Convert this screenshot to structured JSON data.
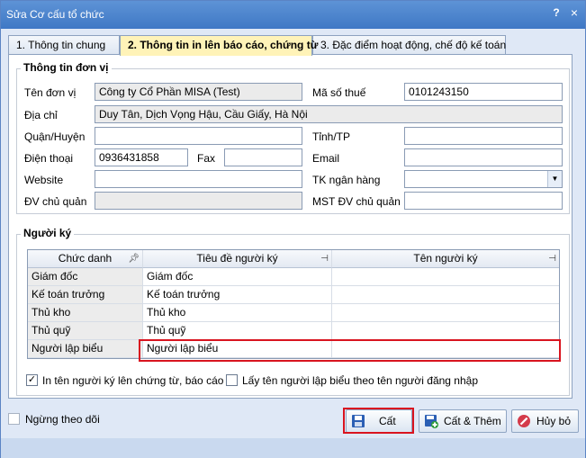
{
  "window": {
    "title": "Sửa Cơ cấu tổ chức",
    "help_label": "?",
    "close_label": "×"
  },
  "tabs": [
    {
      "label": "1. Thông tin chung"
    },
    {
      "label": "2. Thông tin in lên báo cáo, chứng từ"
    },
    {
      "label": "3. Đặc điểm hoạt động, chế độ kế toán"
    }
  ],
  "unit_info": {
    "title": "Thông tin đơn vị",
    "name_label": "Tên đơn vị",
    "name_value": "Công ty Cổ Phần MISA (Test)",
    "tax_label": "Mã số thuế",
    "tax_value": "0101243150",
    "address_label": "Địa chỉ",
    "address_value": "Duy Tân, Dịch Vọng Hậu, Cầu Giấy, Hà Nội",
    "district_label": "Quận/Huyện",
    "district_value": "",
    "province_label": "Tỉnh/TP",
    "province_value": "",
    "phone_label": "Điện thoại",
    "phone_value": "0936431858",
    "fax_label": "Fax",
    "fax_value": "",
    "email_label": "Email",
    "email_value": "",
    "website_label": "Website",
    "website_value": "",
    "bank_label": "TK ngân hàng",
    "bank_value": "",
    "parent_label": "ĐV chủ quản",
    "parent_value": "",
    "parent_tax_label": "MST ĐV chủ quản",
    "parent_tax_value": ""
  },
  "signers": {
    "title": "Người ký",
    "columns": [
      "Chức danh",
      "Tiêu đề người ký",
      "Tên người ký"
    ],
    "rows": [
      {
        "role": "Giám đốc",
        "title": "Giám đốc",
        "name": ""
      },
      {
        "role": "Kế toán trưởng",
        "title": "Kế toán trưởng",
        "name": ""
      },
      {
        "role": "Thủ kho",
        "title": "Thủ kho",
        "name": ""
      },
      {
        "role": "Thủ quỹ",
        "title": "Thủ quỹ",
        "name": ""
      },
      {
        "role": "Người lập biểu",
        "title": "Người lập biểu",
        "name": ""
      }
    ],
    "print_names_label": "In tên người ký lên chứng từ, báo cáo",
    "print_names_checked": true,
    "login_name_label": "Lấy tên người lập biểu theo tên người đăng nhập",
    "login_name_checked": false
  },
  "footer": {
    "stop_tracking_label": "Ngừng theo dõi",
    "save_label": "Cất",
    "save_add_label": "Cất & Thêm",
    "cancel_label": "Hủy bỏ"
  },
  "colors": {
    "highlight_border": "#d9141f",
    "active_tab": "#fff3b8",
    "titlebar": "#4a85cf"
  }
}
